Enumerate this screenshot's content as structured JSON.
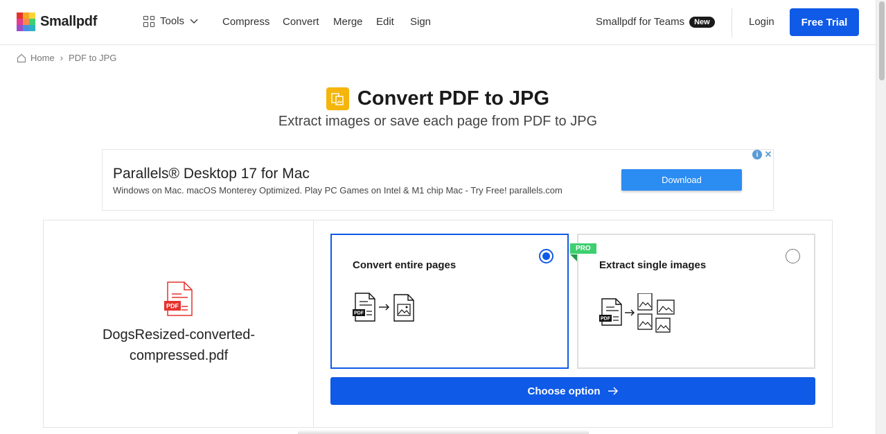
{
  "header": {
    "logo_text": "Smallpdf",
    "tools_label": "Tools",
    "nav": [
      "Compress",
      "Convert",
      "Merge",
      "Edit",
      "Sign"
    ],
    "teams_label": "Smallpdf for Teams",
    "teams_badge": "New",
    "login_label": "Login",
    "trial_label": "Free Trial"
  },
  "breadcrumb": {
    "home": "Home",
    "separator": "›",
    "current": "PDF to JPG"
  },
  "page": {
    "title": "Convert PDF to JPG",
    "subtitle": "Extract images or save each page from PDF to JPG"
  },
  "ad": {
    "title": "Parallels® Desktop 17 for Mac",
    "text": "Windows on Mac. macOS Monterey Optimized. Play PC Games on Intel & M1 chip Mac - Try Free! parallels.com",
    "button": "Download",
    "info_icon": "i",
    "close_icon": "✕"
  },
  "file": {
    "badge": "PDF",
    "name_line1": "DogsResized-converted-",
    "name_line2": "compressed.pdf"
  },
  "options": {
    "entire_pages": {
      "label": "Convert entire pages",
      "selected": true
    },
    "single_images": {
      "label": "Extract single images",
      "selected": false,
      "badge": "PRO"
    }
  },
  "choose_button": "Choose option",
  "colors": {
    "brand_blue": "#0f5ae6",
    "pro_green": "#3ecf6f",
    "title_icon_yellow": "#f5b50b",
    "pdf_red": "#e5322d"
  }
}
